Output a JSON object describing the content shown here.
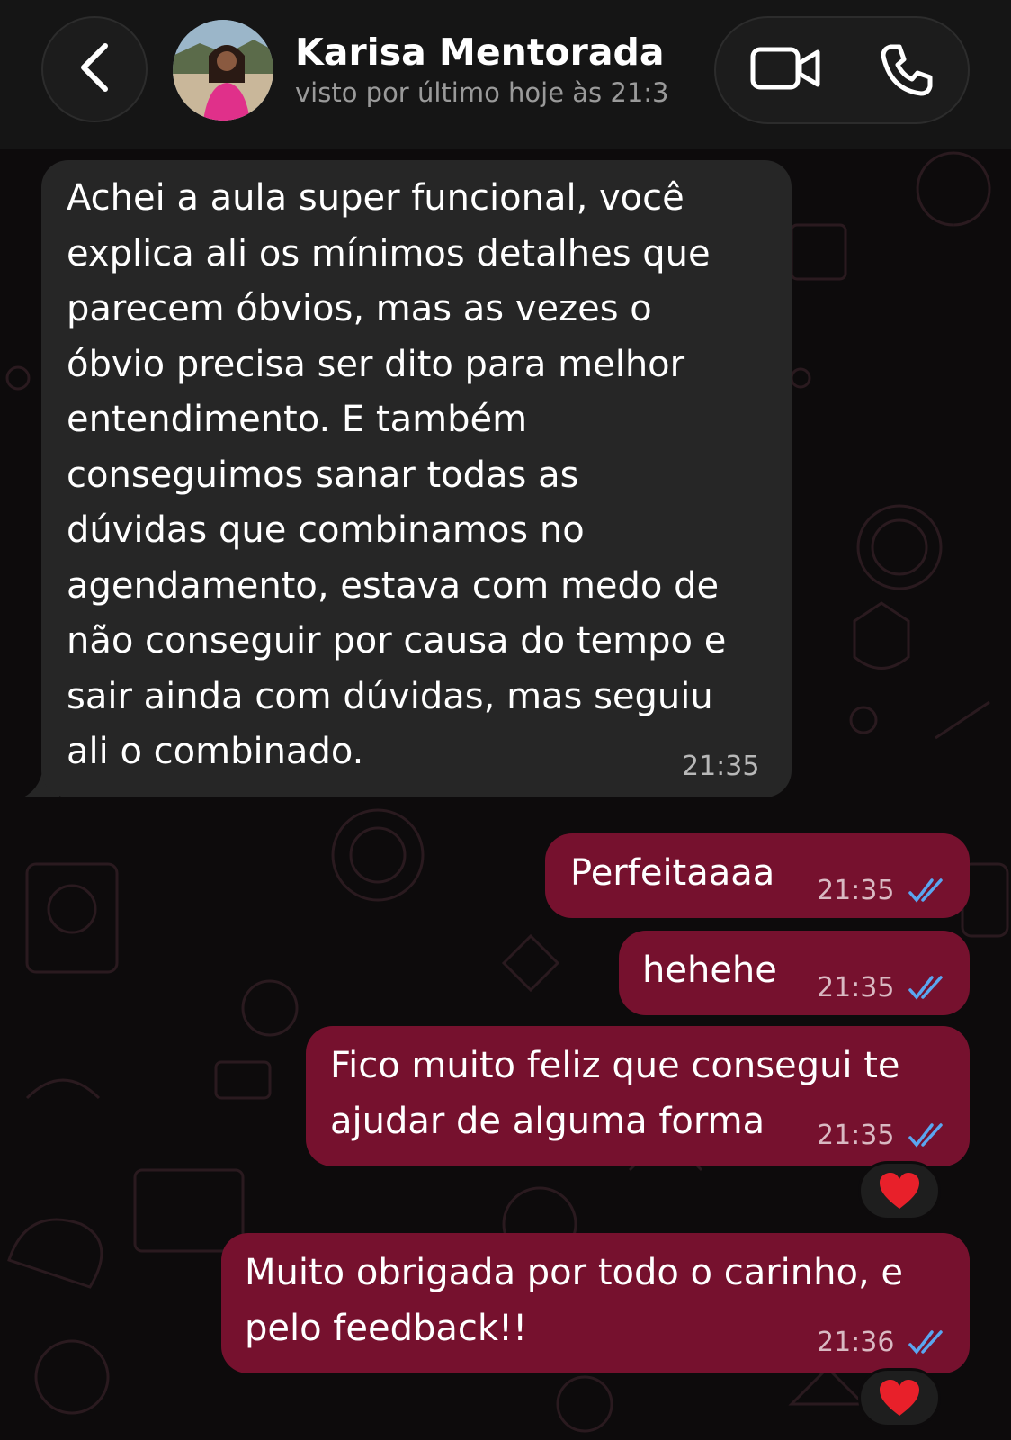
{
  "header": {
    "contact_name": "Karisa Mentorada",
    "status": "visto por último hoje às 21:3",
    "icons": [
      "chevron-left-icon",
      "video-call-icon",
      "phone-icon"
    ]
  },
  "colors": {
    "incoming_bubble": "#262626",
    "outgoing_bubble": "#76112e",
    "read_ticks": "#5aa6f0",
    "reaction_heart": "#e8202a"
  },
  "messages": [
    {
      "direction": "incoming",
      "lines": [
        "Achei a aula super funcional, você",
        "explica ali os mínimos detalhes que",
        "parecem óbvios, mas as vezes o",
        "óbvio precisa ser dito para melhor",
        "entendimento. E também",
        "conseguimos sanar todas as",
        "dúvidas que combinamos no",
        "agendamento, estava com medo de",
        "não conseguir por causa do tempo e",
        "sair ainda com dúvidas, mas seguiu",
        "ali o combinado."
      ],
      "time": "21:35"
    },
    {
      "direction": "outgoing",
      "lines": [
        "Perfeitaaaa"
      ],
      "time": "21:35",
      "read": true
    },
    {
      "direction": "outgoing",
      "lines": [
        "hehehe"
      ],
      "time": "21:35",
      "read": true
    },
    {
      "direction": "outgoing",
      "lines": [
        "Fico muito feliz que consegui te",
        "ajudar de alguma forma"
      ],
      "time": "21:35",
      "read": true,
      "reaction": "❤️"
    },
    {
      "direction": "outgoing",
      "lines": [
        "Muito obrigada por todo o carinho, e",
        "pelo feedback!!"
      ],
      "time": "21:36",
      "read": true,
      "reaction": "❤️"
    }
  ]
}
